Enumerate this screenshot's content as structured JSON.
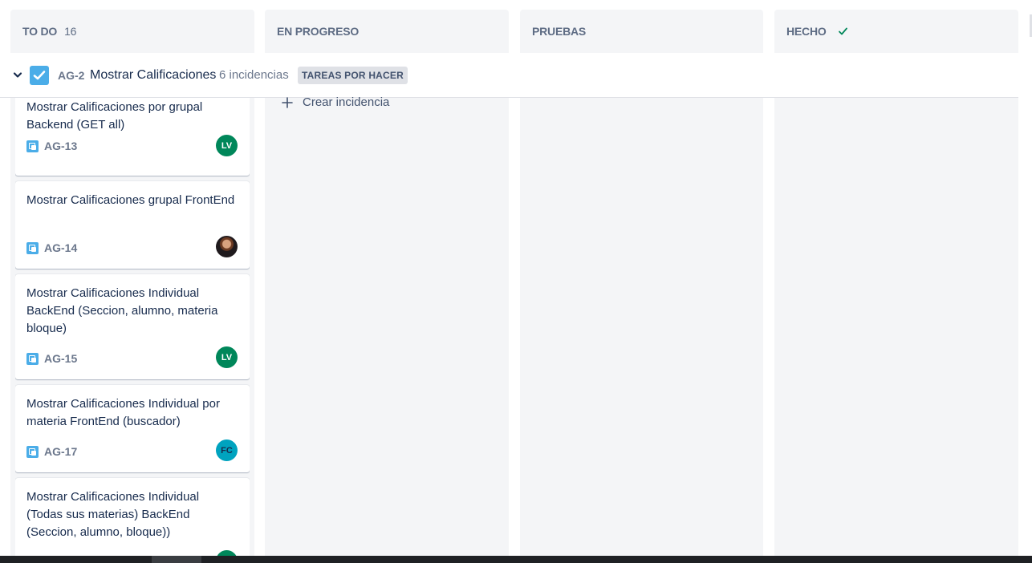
{
  "columns": [
    {
      "name": "TO DO",
      "count": "16"
    },
    {
      "name": "EN PROGRESO"
    },
    {
      "name": "PRUEBAS"
    },
    {
      "name": "HECHO"
    }
  ],
  "swimlane": {
    "key": "AG-2",
    "title": "Mostrar Calificaciones",
    "issue_count": "6 incidencias",
    "status_badge": "TAREAS POR HACER"
  },
  "cards": [
    {
      "title": "Mostrar Calificaciones por grupal Backend (GET all)",
      "key": "AG-13",
      "assignee_initials": "LV",
      "assignee_color": "#00875a"
    },
    {
      "title": "Mostrar Calificaciones grupal FrontEnd",
      "key": "AG-14",
      "assignee_initials": "",
      "assignee_color": "#4a2b1d"
    },
    {
      "title": "Mostrar Calificaciones Individual BackEnd (Seccion, alumno, materia bloque)",
      "key": "AG-15",
      "assignee_initials": "LV",
      "assignee_color": "#00875a"
    },
    {
      "title": "Mostrar Calificaciones Individual por materia FrontEnd (buscador)",
      "key": "AG-17",
      "assignee_initials": "FC",
      "assignee_color": "#00a3bf"
    },
    {
      "title": "Mostrar Calificaciones Individual (Todas sus materias) BackEnd (Seccion, alumno, bloque))",
      "key": "",
      "assignee_initials": "",
      "assignee_color": "#00875a"
    }
  ],
  "create_issue_label": "Crear incidencia",
  "icons": {
    "collapse": "chevron-down-icon",
    "epic": "checkbox-icon",
    "task": "task-icon",
    "done": "check-icon",
    "add": "plus-icon"
  },
  "colors": {
    "column_bg": "#f4f5f7",
    "epic_blue": "#4bade8",
    "done_green": "#00875a"
  }
}
